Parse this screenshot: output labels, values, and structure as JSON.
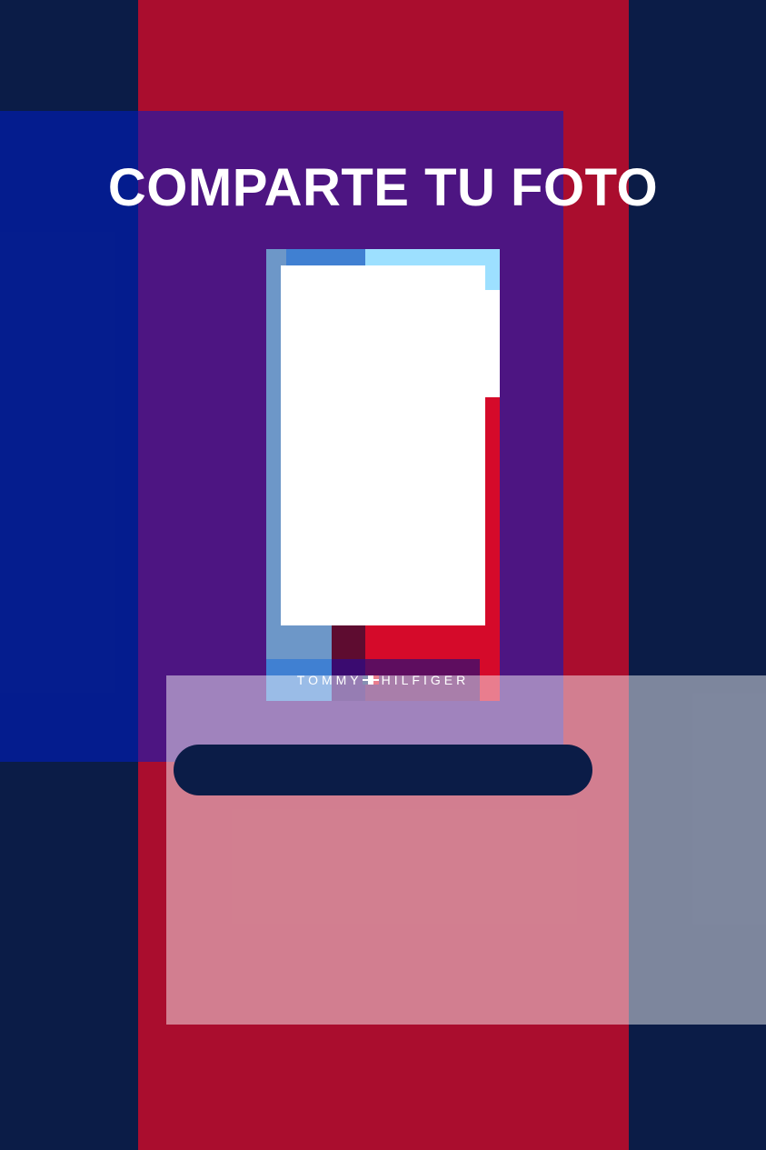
{
  "title": "COMPARTE TU FOTO",
  "frame": {
    "brand_left": "TOMMY",
    "brand_right": "HILFIGER",
    "logo_icon": "flag-icon"
  },
  "share_button": {
    "label": ""
  },
  "colors": {
    "navy": "#0b1c47",
    "red": "#aa0d2e",
    "bright_red": "#d50a2a",
    "blue": "#4080d2",
    "light_blue": "#9de0ff",
    "purple": "#5e0d5f"
  }
}
